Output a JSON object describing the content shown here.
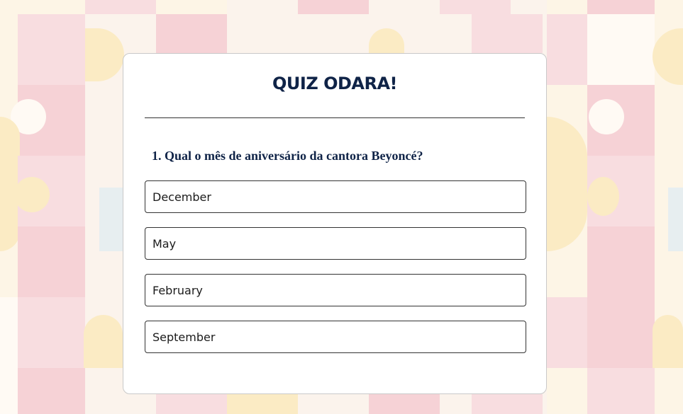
{
  "quiz": {
    "title": "QUIZ ODARA!",
    "question": "1. Qual o mês de aniversário da cantora Beyoncé?",
    "options": [
      "December",
      "May",
      "February",
      "September"
    ]
  },
  "colors": {
    "title": "#0f2347",
    "card_background": "#ffffff",
    "page_background": "#fbf3ec"
  }
}
